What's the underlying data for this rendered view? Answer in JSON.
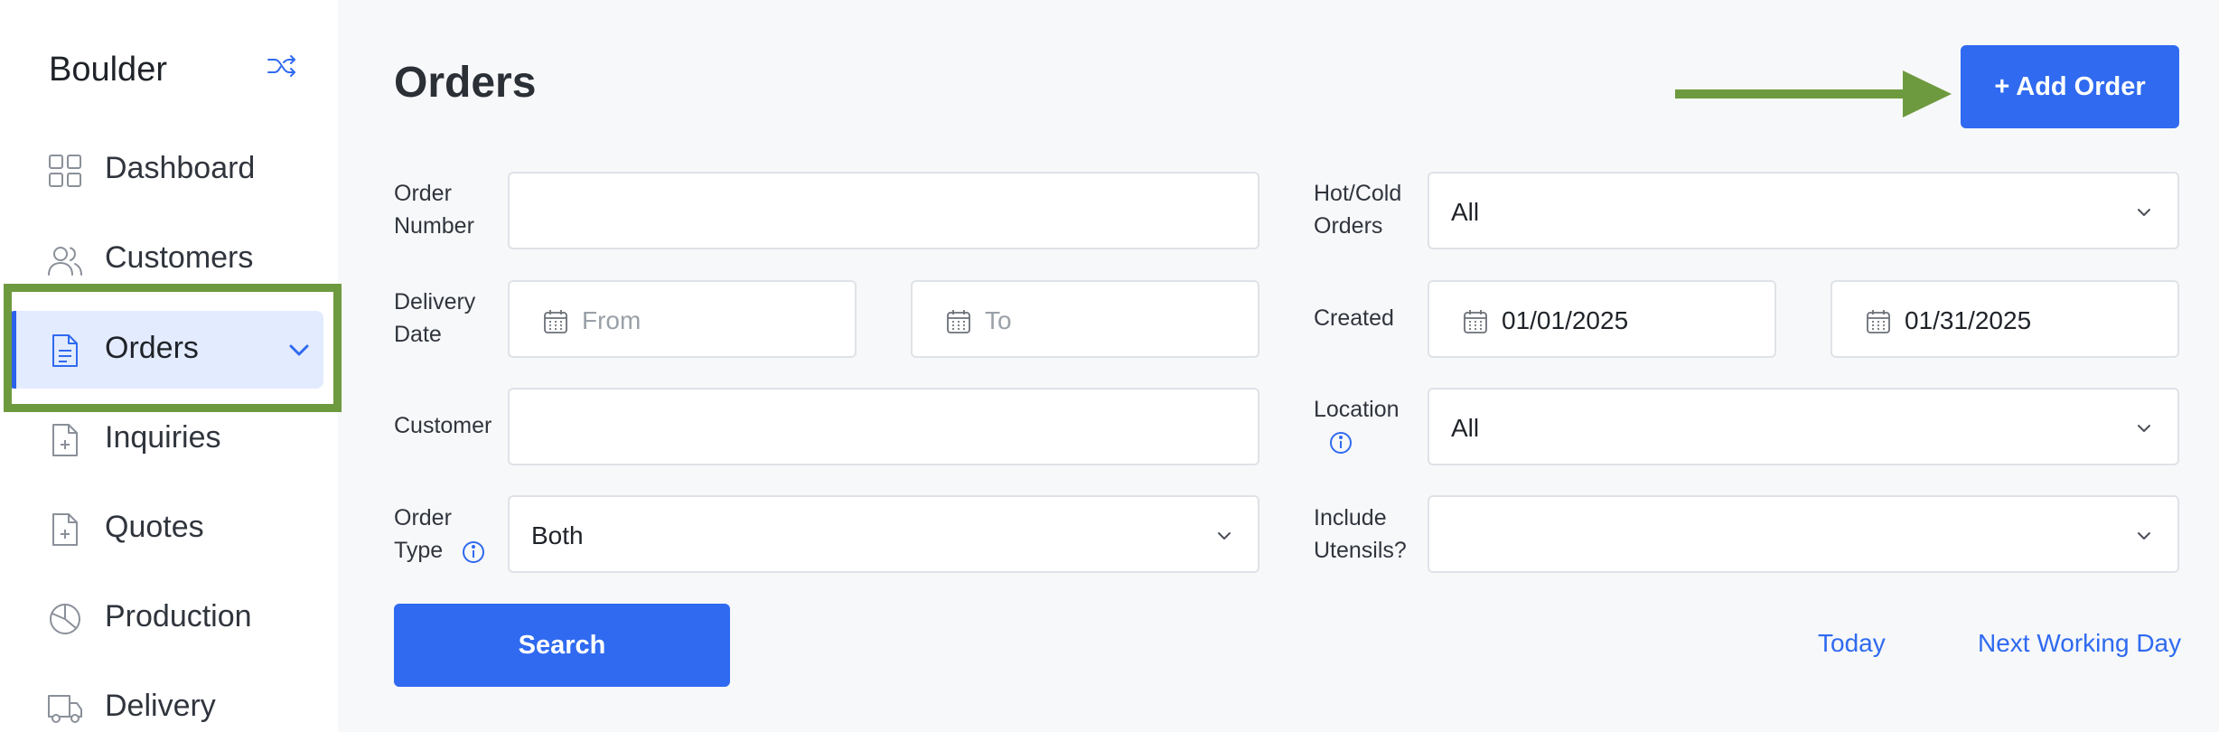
{
  "sidebar": {
    "brand": "Boulder",
    "items": [
      {
        "label": "Dashboard",
        "icon": "grid-icon"
      },
      {
        "label": "Customers",
        "icon": "users-icon"
      },
      {
        "label": "Orders",
        "icon": "document-icon",
        "active": true
      },
      {
        "label": "Inquiries",
        "icon": "file-plus-icon"
      },
      {
        "label": "Quotes",
        "icon": "file-plus-icon"
      },
      {
        "label": "Production",
        "icon": "pie-chart-icon"
      },
      {
        "label": "Delivery",
        "icon": "truck-icon"
      }
    ]
  },
  "page": {
    "title": "Orders",
    "add_button": "+ Add Order"
  },
  "filters": {
    "order_number": {
      "label_line1": "Order",
      "label_line2": "Number",
      "value": ""
    },
    "delivery_date": {
      "label_line1": "Delivery",
      "label_line2": "Date",
      "from_placeholder": "From",
      "to_placeholder": "To"
    },
    "customer": {
      "label": "Customer",
      "value": ""
    },
    "order_type": {
      "label_line1": "Order",
      "label_line2": "Type",
      "value": "Both"
    },
    "hot_cold": {
      "label_line1": "Hot/Cold",
      "label_line2": "Orders",
      "value": "All"
    },
    "created": {
      "label": "Created",
      "from": "01/01/2025",
      "to": "01/31/2025"
    },
    "location": {
      "label": "Location",
      "value": "All"
    },
    "utensils": {
      "label_line1": "Include",
      "label_line2": "Utensils?",
      "value": ""
    }
  },
  "actions": {
    "search": "Search",
    "today": "Today",
    "next_working_day": "Next Working Day"
  },
  "colors": {
    "primary": "#2f6af0",
    "active_bg": "#e3ebff",
    "annotation_green": "#6e9a3f"
  }
}
